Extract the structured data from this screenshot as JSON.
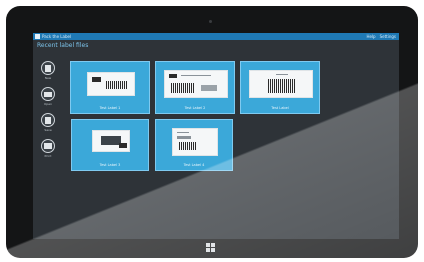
{
  "window": {
    "title": "Pack the Label",
    "toolbar_items": [
      "Help",
      "Settings"
    ]
  },
  "page": {
    "heading": "Recent label files"
  },
  "sidebar": {
    "items": [
      {
        "label": "New",
        "icon": "new-file-icon"
      },
      {
        "label": "Open",
        "icon": "folder-open-icon"
      },
      {
        "label": "Save",
        "icon": "save-icon"
      },
      {
        "label": "Print",
        "icon": "print-icon"
      }
    ]
  },
  "tiles": [
    {
      "label": "Test Label 1"
    },
    {
      "label": "Test Label 2"
    },
    {
      "label": "Test Label"
    },
    {
      "label": "Test Label 3"
    },
    {
      "label": "Test Label 4"
    }
  ],
  "colors": {
    "bezel": "#141516",
    "screen_bg": "#2e3338",
    "titlebar": "#1f79b5",
    "tile": "#3ba8d9",
    "heading": "#7cc3ea"
  },
  "taskbar": {
    "start_icon": "windows-logo-icon"
  }
}
